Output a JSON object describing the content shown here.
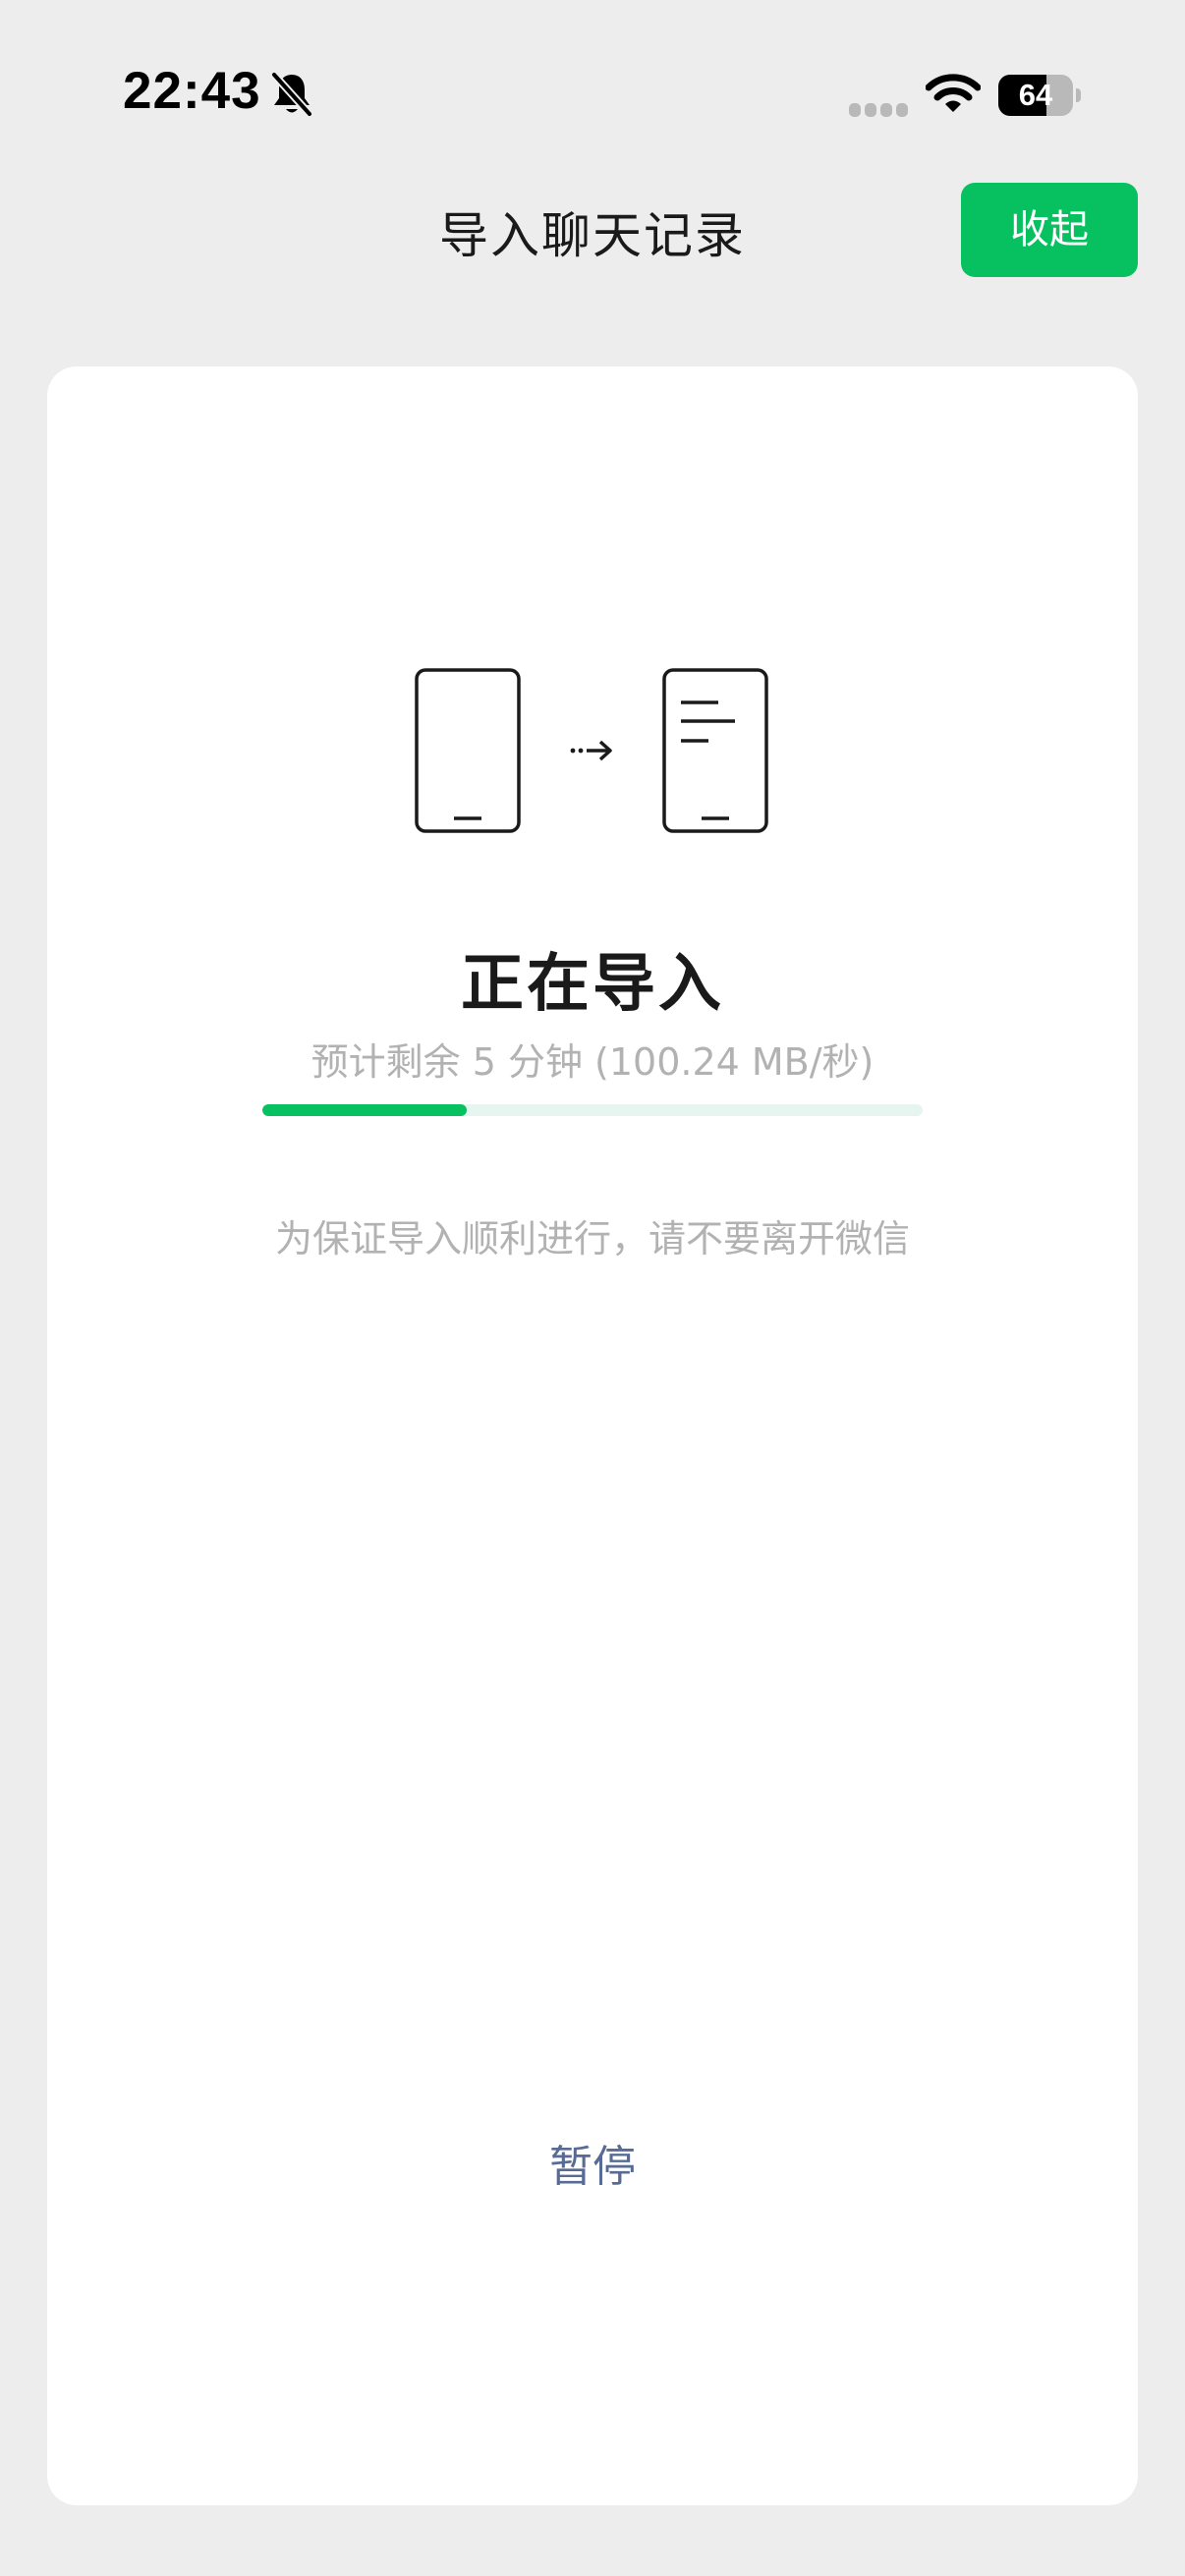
{
  "status_bar": {
    "time": "22:43",
    "battery_level": "64",
    "battery_fraction": 0.64,
    "icons": [
      "bell-slash-icon",
      "cellular-signal-icon",
      "wifi-icon",
      "battery-icon"
    ]
  },
  "header": {
    "title": "导入聊天记录",
    "collapse_label": "收起"
  },
  "main": {
    "illustration_icons": [
      "source-phone-icon",
      "transfer-arrow-icon",
      "destination-phone-icon"
    ],
    "status": "正在导入",
    "eta": "预计剩余 5 分钟 (100.24 MB/秒)",
    "progress_fraction": 0.31,
    "notice": "为保证导入顺利进行，请不要离开微信",
    "pause_label": "暂停"
  },
  "colors": {
    "accent": "#07c160",
    "link": "#576b95",
    "background": "#ededed",
    "card": "#ffffff",
    "muted_text": "#b2b2b2"
  }
}
